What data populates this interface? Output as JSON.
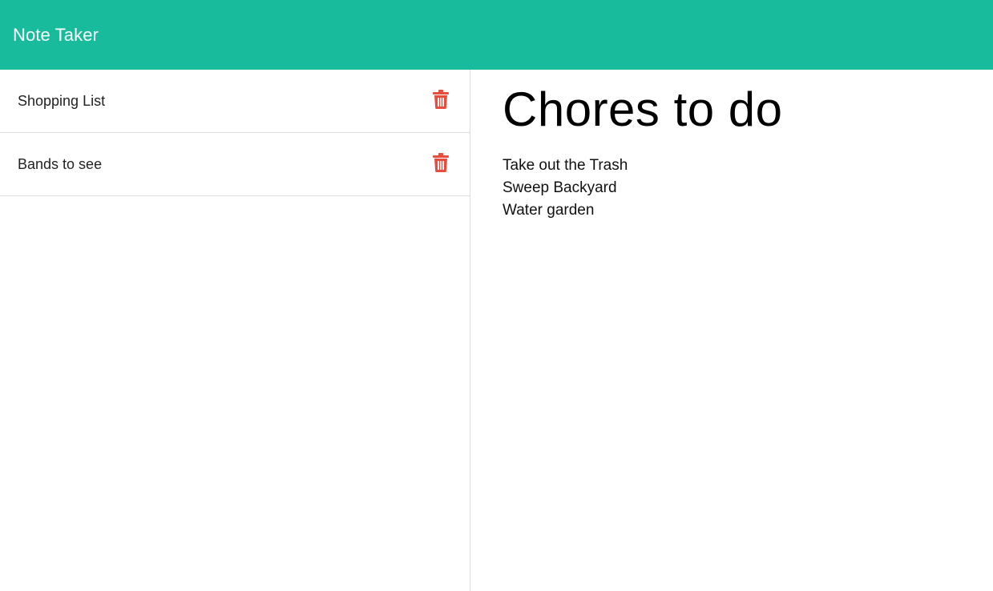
{
  "navbar": {
    "brand": "Note Taker"
  },
  "sidebar": {
    "notes": [
      {
        "title": "Shopping List",
        "icon": "trash-icon"
      },
      {
        "title": "Bands to see",
        "icon": "trash-icon"
      }
    ]
  },
  "main": {
    "title": "Chores to do",
    "lines": [
      "Take out the Trash",
      "Sweep Backyard",
      "Water garden"
    ]
  },
  "colors": {
    "navbar": "#18bc9c",
    "delete": "#e74c3c",
    "divider": "#dddddd"
  }
}
